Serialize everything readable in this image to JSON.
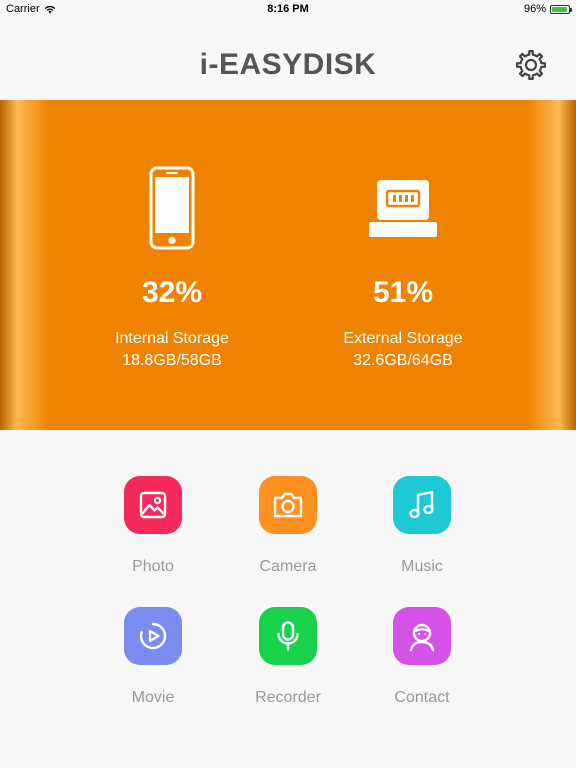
{
  "status_bar": {
    "carrier": "Carrier",
    "time": "8:16 PM",
    "battery": "96%",
    "battery_level": 0.96
  },
  "header": {
    "title": "i-EASYDISK",
    "settings_icon": "gear-icon"
  },
  "storage": {
    "internal": {
      "percent": "32%",
      "label": "Internal Storage",
      "size": "18.8GB/58GB",
      "icon": "phone-icon"
    },
    "external": {
      "percent": "51%",
      "label": "External Storage",
      "size": "32.6GB/64GB",
      "icon": "lightning-connector-icon"
    },
    "colors": {
      "banner": "#ef8300"
    }
  },
  "features": [
    {
      "label": "Photo",
      "icon": "image-icon",
      "color": "#f5295c"
    },
    {
      "label": "Camera",
      "icon": "camera-icon",
      "color": "#ff8f1e"
    },
    {
      "label": "Music",
      "icon": "music-note-icon",
      "color": "#1ec9d6"
    },
    {
      "label": "Movie",
      "icon": "play-icon",
      "color": "#7b8cf0"
    },
    {
      "label": "Recorder",
      "icon": "microphone-icon",
      "color": "#17d34b"
    },
    {
      "label": "Contact",
      "icon": "person-icon",
      "color": "#d552e8"
    }
  ]
}
